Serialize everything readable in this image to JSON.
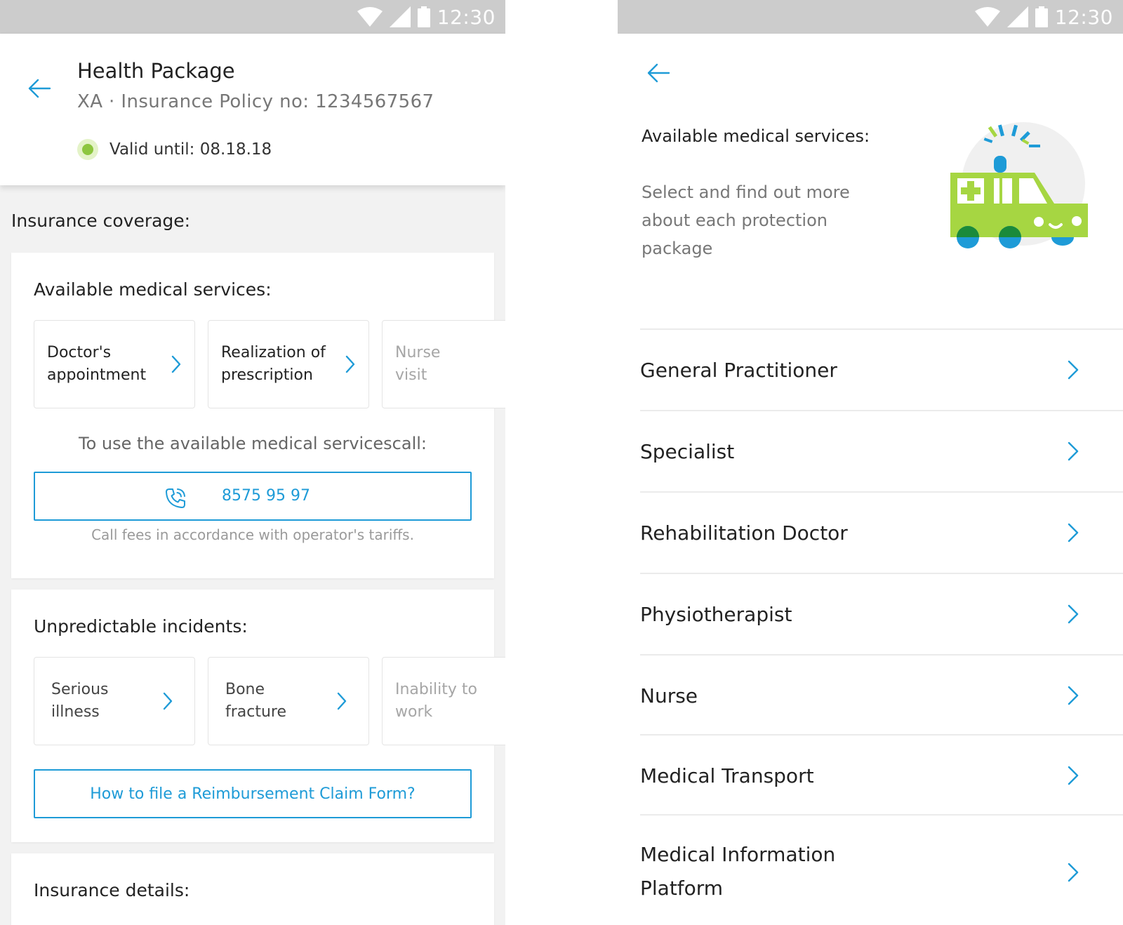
{
  "left": {
    "status_time": "12:30",
    "header": {
      "title": "Health Package",
      "subtitle": "XA · Insurance Policy no: 1234567567",
      "valid": "Valid until: 08.18.18"
    },
    "coverage_heading": "Insurance coverage:",
    "medical": {
      "title": "Available medical services:",
      "tiles": [
        {
          "line1": "Doctor's",
          "line2": "appointment"
        },
        {
          "line1": "Realization of",
          "line2": "prescription"
        },
        {
          "line1": "Nurse",
          "line2": "visit"
        }
      ],
      "call_caption": "To use the available medical servicescall:",
      "phone": "8575 95 97",
      "fees": "Call fees in accordance with operator's tariffs."
    },
    "incidents": {
      "title": "Unpredictable incidents:",
      "tiles": [
        {
          "line1": "Serious",
          "line2": "illness"
        },
        {
          "line1": "Bone",
          "line2": "fracture"
        },
        {
          "line1": "Inability to",
          "line2": "work"
        }
      ],
      "claim_button": "How to file a Reimbursement Claim Form?"
    },
    "details": {
      "title": "Insurance details:"
    }
  },
  "right": {
    "status_time": "12:30",
    "heading": "Available medical services:",
    "description": "Select and find out more about each protection package",
    "items": [
      {
        "label": "General Practitioner"
      },
      {
        "label": "Specialist"
      },
      {
        "label": "Rehabilitation Doctor"
      },
      {
        "label": "Physiotherapist"
      },
      {
        "label": "Nurse"
      },
      {
        "label": "Medical Transport"
      },
      {
        "line1": "Medical Information",
        "line2": "Platform"
      }
    ]
  },
  "icons": {
    "back": "arrow-left-icon",
    "chevron": "chevron-right-icon",
    "phone": "phone-call-icon",
    "wifi": "wifi-icon",
    "signal": "signal-icon",
    "battery": "battery-icon",
    "illustration": "ambulance-illustration"
  },
  "colors": {
    "accent": "#1e9bd7",
    "valid_green": "#8dc63f",
    "ambulance_green": "#a6d642",
    "status_bar": "#cccccc"
  }
}
